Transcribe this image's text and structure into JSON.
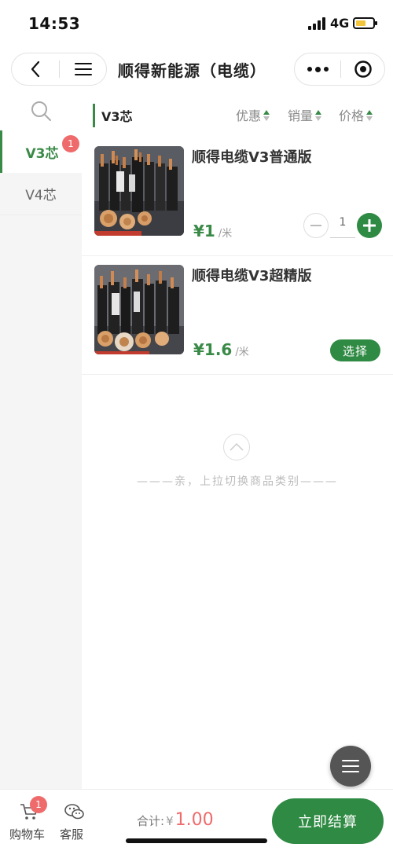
{
  "status": {
    "time": "14:53",
    "network": "4G"
  },
  "nav": {
    "title": "顺得新能源（电缆）"
  },
  "sidebar": {
    "items": [
      {
        "label": "V3芯",
        "badge": "1",
        "active": true
      },
      {
        "label": "V4芯",
        "active": false
      }
    ]
  },
  "filter": {
    "category": "V3芯",
    "sorts": [
      "优惠",
      "销量",
      "价格"
    ]
  },
  "products": [
    {
      "name": "顺得电缆V3普通版",
      "price": "¥1",
      "unit": "/米",
      "quantity": "1"
    },
    {
      "name": "顺得电缆V3超精版",
      "price": "¥1.6",
      "unit": "/米",
      "button": "选择"
    }
  ],
  "pullup_hint": "———亲，上拉切换商品类别———",
  "bottom": {
    "cart_label": "购物车",
    "cart_badge": "1",
    "service_label": "客服",
    "total_label": "合计:",
    "currency": "¥",
    "total_amount": "1.00",
    "checkout_label": "立即结算"
  },
  "colors": {
    "accent": "#2f8a43",
    "badge": "#ef6b6b"
  }
}
